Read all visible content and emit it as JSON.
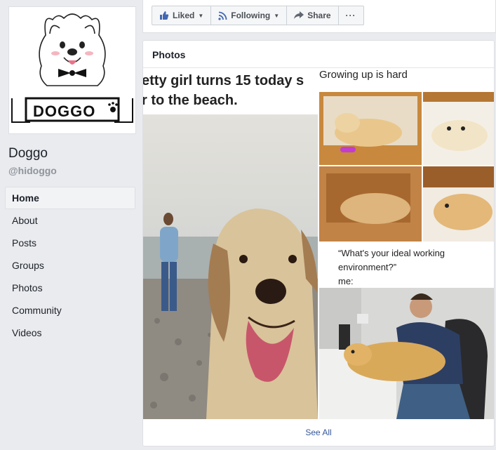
{
  "page": {
    "name": "Doggo",
    "handle": "@hidoggo",
    "logo_text": "DOGGO"
  },
  "nav": {
    "items": [
      {
        "label": "Home",
        "active": true
      },
      {
        "label": "About"
      },
      {
        "label": "Posts"
      },
      {
        "label": "Groups"
      },
      {
        "label": "Photos"
      },
      {
        "label": "Community"
      },
      {
        "label": "Videos"
      }
    ]
  },
  "actions": {
    "liked": "Liked",
    "following": "Following",
    "share": "Share",
    "more": "···"
  },
  "photos": {
    "title": "Photos",
    "see_all": "See All",
    "big_caption": "etty girl turns 15 today s\nr to the beach.",
    "top_right_caption": "Growing up is hard",
    "bottom_right_caption": "“What's your ideal working\nenvironment?”\nme:"
  },
  "colors": {
    "accent": "#4267b2",
    "link": "#365899",
    "background": "#e9ebee"
  }
}
